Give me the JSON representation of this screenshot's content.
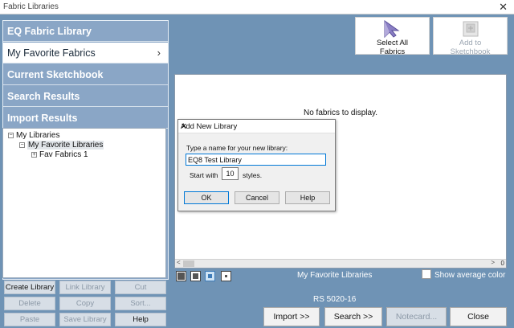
{
  "window": {
    "title": "Fabric Libraries",
    "close_glyph": "✕"
  },
  "nav": {
    "items": [
      {
        "label": "EQ Fabric Library"
      },
      {
        "label": "My Favorite Fabrics",
        "chevron": "›"
      },
      {
        "label": "Current Sketchbook"
      },
      {
        "label": "Search Results"
      },
      {
        "label": "Import Results"
      }
    ]
  },
  "tree": {
    "root": "My Libraries",
    "child": "My Favorite Libraries",
    "grandchild": "Fav Fabrics 1",
    "minus": "−",
    "plus": "+"
  },
  "library_buttons": {
    "create": "Create Library",
    "link": "Link Library",
    "cut": "Cut",
    "delete": "Delete",
    "copy": "Copy",
    "sort": "Sort...",
    "paste": "Paste",
    "save": "Save Library",
    "help": "Help"
  },
  "top_buttons": {
    "select_all": {
      "line1": "Select All",
      "line2": "Fabrics",
      "icon": "cursor-select-icon"
    },
    "add_sketchbook": {
      "line1": "Add to",
      "line2": "Sketchbook",
      "icon": "add-to-sketchbook-icon"
    }
  },
  "fabric_area": {
    "empty_text": "No fabrics to display.",
    "scroll_count": "0",
    "left_arrow": "<",
    "right_arrow": ">"
  },
  "current_library": "My Favorite Libraries",
  "show_average_color": {
    "label": "Show average color",
    "checked": false
  },
  "status": "RS 5020-16",
  "bottom_buttons": {
    "import": "Import    >>",
    "search": "Search    >>",
    "notecard": "Notecard...",
    "close": "Close"
  },
  "dialog": {
    "title": "Add New Library",
    "close_glyph": "✕",
    "prompt": "Type a name for your new library:",
    "name_value": "EQ8 Test Library",
    "start_with_label": "Start with",
    "start_with_value": "10",
    "styles_label": "styles.",
    "ok": "OK",
    "cancel": "Cancel",
    "help": "Help"
  },
  "colors": {
    "background": "#6f93b5",
    "nav_panel": "#8aa6c6",
    "disabled_button": "#d7dee6",
    "focus_blue": "#0078d7"
  }
}
